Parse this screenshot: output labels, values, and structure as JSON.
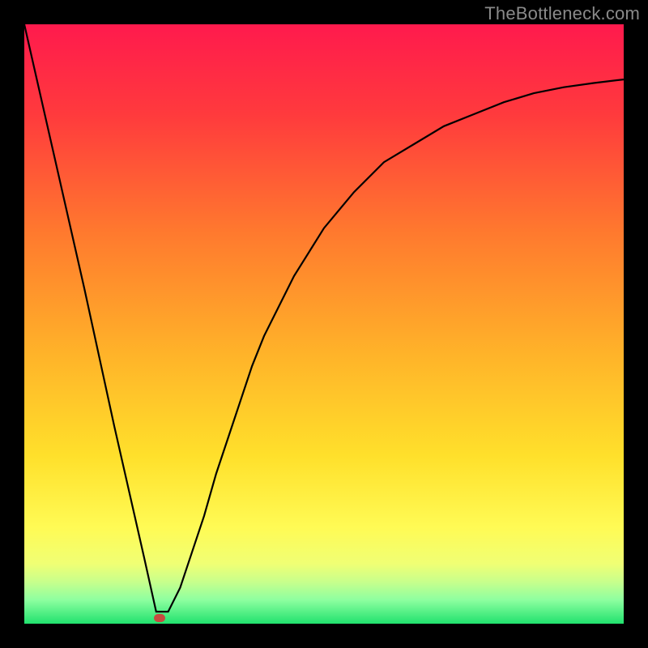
{
  "attribution": "TheBottleneck.com",
  "chart_data": {
    "type": "line",
    "title": "",
    "xlabel": "",
    "ylabel": "",
    "xlim": [
      0,
      100
    ],
    "ylim": [
      0,
      100
    ],
    "series": [
      {
        "name": "curve",
        "x": [
          0,
          5,
          10,
          15,
          20,
          22,
          24,
          26,
          28,
          30,
          32,
          34,
          36,
          38,
          40,
          45,
          50,
          55,
          60,
          65,
          70,
          75,
          80,
          85,
          90,
          95,
          100
        ],
        "y": [
          100,
          78,
          56,
          33,
          11,
          2,
          2,
          6,
          12,
          18,
          25,
          31,
          37,
          43,
          48,
          58,
          66,
          72,
          77,
          80,
          83,
          85,
          87,
          88.5,
          89.5,
          90.2,
          90.8
        ]
      }
    ],
    "marker": {
      "x": 22.5,
      "y": 1,
      "color": "#c64b3f"
    },
    "gradient_stops": [
      {
        "pct": 0,
        "color": "#ff1a4d"
      },
      {
        "pct": 15,
        "color": "#ff3a3d"
      },
      {
        "pct": 35,
        "color": "#ff7a2e"
      },
      {
        "pct": 55,
        "color": "#ffb329"
      },
      {
        "pct": 72,
        "color": "#ffe02b"
      },
      {
        "pct": 84,
        "color": "#fffb55"
      },
      {
        "pct": 90,
        "color": "#f0ff74"
      },
      {
        "pct": 93,
        "color": "#c8ff8c"
      },
      {
        "pct": 96,
        "color": "#8effa0"
      },
      {
        "pct": 100,
        "color": "#21e26e"
      }
    ]
  }
}
